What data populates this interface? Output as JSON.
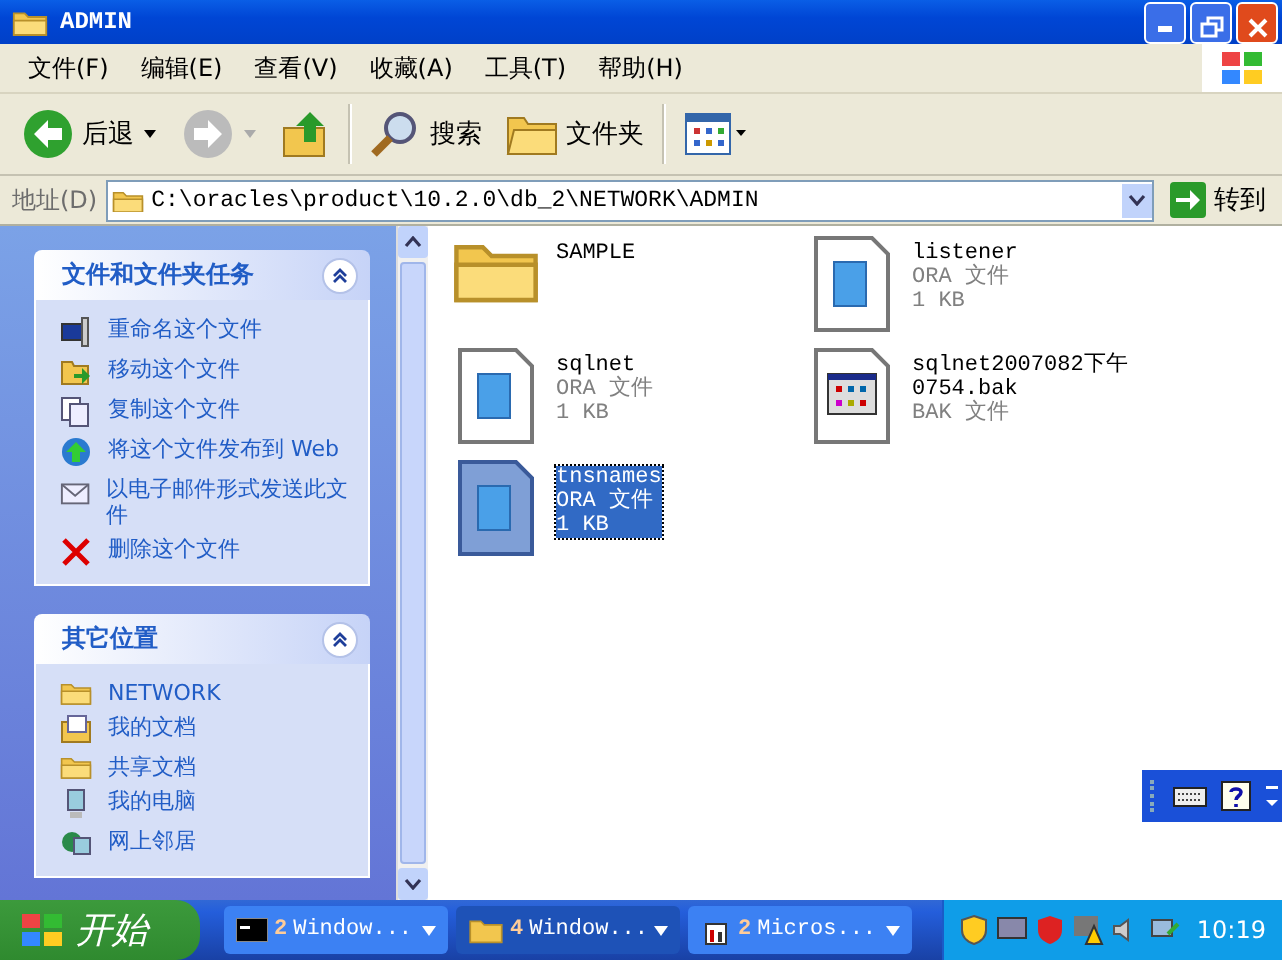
{
  "window": {
    "title": "ADMIN"
  },
  "menu": [
    "文件(F)",
    "编辑(E)",
    "查看(V)",
    "收藏(A)",
    "工具(T)",
    "帮助(H)"
  ],
  "toolbar": [
    {
      "kind": "back",
      "label": "后退",
      "disabled": false
    },
    {
      "kind": "forward",
      "disabled": true
    },
    {
      "kind": "up"
    },
    {
      "kind": "search",
      "label": "搜索"
    },
    {
      "kind": "folders",
      "label": "文件夹"
    },
    {
      "kind": "views"
    }
  ],
  "address": {
    "label": "地址(D)",
    "value": "C:\\oracles\\product\\10.2.0\\db_2\\NETWORK\\ADMIN",
    "go": "转到"
  },
  "panels": [
    {
      "title": "文件和文件夹任务",
      "expanded": true,
      "items": [
        {
          "kind": "rename",
          "label": "重命名这个文件"
        },
        {
          "kind": "move",
          "label": "移动这个文件"
        },
        {
          "kind": "copy",
          "label": "复制这个文件"
        },
        {
          "kind": "publish",
          "label": "将这个文件发布到 Web"
        },
        {
          "kind": "email",
          "label": "以电子邮件形式发送此文件"
        },
        {
          "kind": "delete",
          "label": "删除这个文件"
        }
      ]
    },
    {
      "title": "其它位置",
      "expanded": true,
      "items": [
        {
          "kind": "folder",
          "label": "NETWORK"
        },
        {
          "kind": "documents",
          "label": "我的文档"
        },
        {
          "kind": "folder",
          "label": "共享文档"
        },
        {
          "kind": "computer",
          "label": "我的电脑"
        },
        {
          "kind": "network",
          "label": "网上邻居"
        }
      ]
    }
  ],
  "files": [
    {
      "kind": "folder",
      "name": "SAMPLE",
      "selected": false
    },
    {
      "kind": "ora",
      "name": "listener",
      "type": "ORA 文件",
      "size": "1 KB",
      "selected": false
    },
    {
      "kind": "ora",
      "name": "sqlnet",
      "type": "ORA 文件",
      "size": "1 KB",
      "selected": false
    },
    {
      "kind": "bak",
      "name": "sqlnet2007082下午0754.bak",
      "type": "BAK 文件",
      "selected": false
    },
    {
      "kind": "ora",
      "name": "tnsnames",
      "type": "ORA 文件",
      "size": "1 KB",
      "selected": true
    }
  ],
  "taskbar": {
    "start": "开始",
    "buttons": [
      {
        "kind": "console",
        "count": "2",
        "label": "Window...",
        "selected": false
      },
      {
        "kind": "folder",
        "count": "4",
        "label": "Window...",
        "selected": true
      },
      {
        "kind": "office",
        "count": "2",
        "label": "Micros...",
        "selected": false
      }
    ],
    "clock": "10:19"
  }
}
